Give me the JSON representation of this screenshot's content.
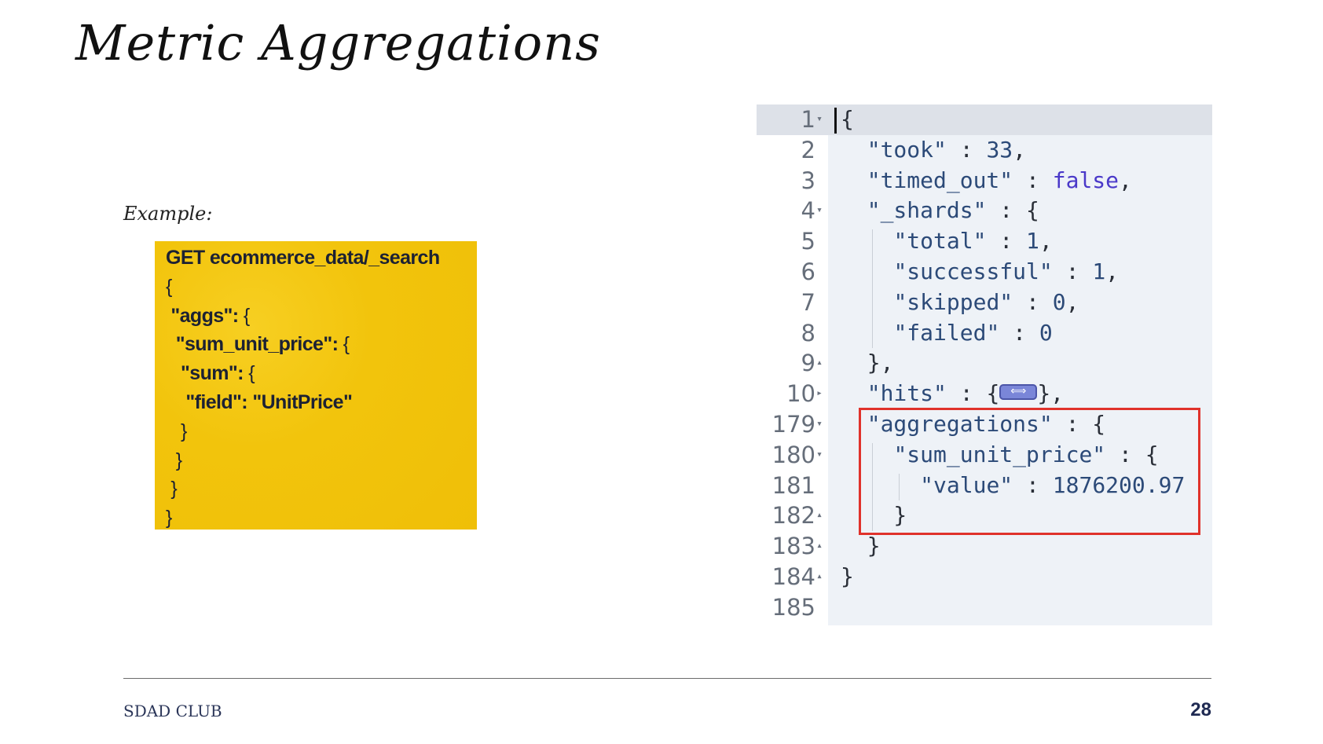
{
  "slide": {
    "title": "Metric Aggregations",
    "example_label": "Example:",
    "footer_left": "SDAD CLUB",
    "page_number": "28"
  },
  "query": {
    "lines": [
      {
        "bold": "GET ecommerce_data/_search",
        "rest": ""
      },
      {
        "bold": "",
        "rest": "{"
      },
      {
        "bold": " \"aggs\":",
        "rest": " {"
      },
      {
        "bold": "  \"sum_unit_price\":",
        "rest": " {"
      },
      {
        "bold": "   \"sum\":",
        "rest": " {"
      },
      {
        "bold": "    \"field\": \"UnitPrice\"",
        "rest": ""
      },
      {
        "bold": "",
        "rest": "   }"
      },
      {
        "bold": "",
        "rest": "  }"
      },
      {
        "bold": "",
        "rest": " }"
      },
      {
        "bold": "",
        "rest": "}"
      }
    ]
  },
  "response": {
    "lines": [
      {
        "num": "1",
        "fold": "▾",
        "code": "{"
      },
      {
        "num": "2",
        "fold": "",
        "code": "  \"took\" : 33,"
      },
      {
        "num": "3",
        "fold": "",
        "code": "  \"timed_out\" : false,"
      },
      {
        "num": "4",
        "fold": "▾",
        "code": "  \"_shards\" : {"
      },
      {
        "num": "5",
        "fold": "",
        "code": "    \"total\" : 1,"
      },
      {
        "num": "6",
        "fold": "",
        "code": "    \"successful\" : 1,"
      },
      {
        "num": "7",
        "fold": "",
        "code": "    \"skipped\" : 0,"
      },
      {
        "num": "8",
        "fold": "",
        "code": "    \"failed\" : 0"
      },
      {
        "num": "9",
        "fold": "▴",
        "code": "  },"
      },
      {
        "num": "10",
        "fold": "▸",
        "code": "  \"hits\" : {⟺},"
      },
      {
        "num": "179",
        "fold": "▾",
        "code": "  \"aggregations\" : {"
      },
      {
        "num": "180",
        "fold": "▾",
        "code": "    \"sum_unit_price\" : {"
      },
      {
        "num": "181",
        "fold": "",
        "code": "      \"value\" : 1876200.97"
      },
      {
        "num": "182",
        "fold": "▴",
        "code": "    }"
      },
      {
        "num": "183",
        "fold": "▴",
        "code": "  }"
      },
      {
        "num": "184",
        "fold": "▴",
        "code": "}"
      },
      {
        "num": "185",
        "fold": "",
        "code": ""
      }
    ]
  }
}
